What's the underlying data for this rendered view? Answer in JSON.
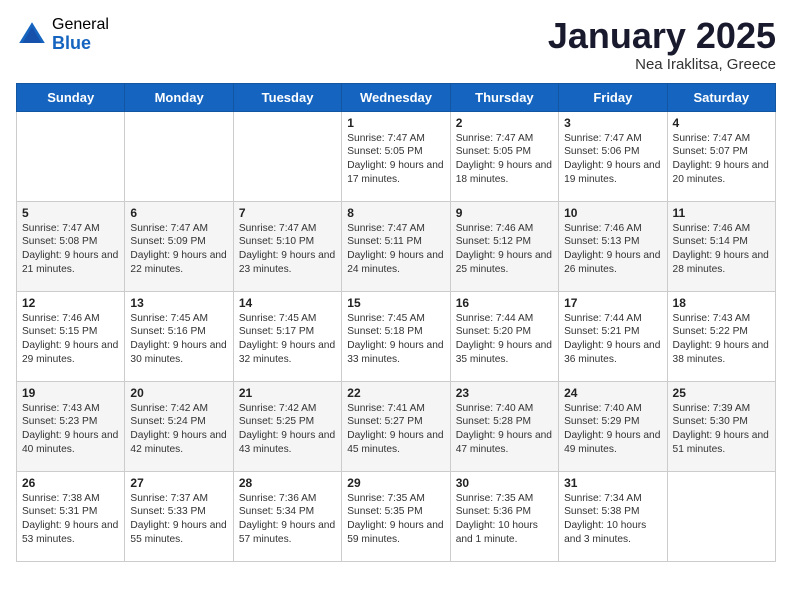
{
  "header": {
    "logo_general": "General",
    "logo_blue": "Blue",
    "title": "January 2025",
    "subtitle": "Nea Iraklitsa, Greece"
  },
  "weekdays": [
    "Sunday",
    "Monday",
    "Tuesday",
    "Wednesday",
    "Thursday",
    "Friday",
    "Saturday"
  ],
  "weeks": [
    [
      {
        "date": "",
        "info": ""
      },
      {
        "date": "",
        "info": ""
      },
      {
        "date": "",
        "info": ""
      },
      {
        "date": "1",
        "info": "Sunrise: 7:47 AM\nSunset: 5:05 PM\nDaylight: 9 hours and 17 minutes."
      },
      {
        "date": "2",
        "info": "Sunrise: 7:47 AM\nSunset: 5:05 PM\nDaylight: 9 hours and 18 minutes."
      },
      {
        "date": "3",
        "info": "Sunrise: 7:47 AM\nSunset: 5:06 PM\nDaylight: 9 hours and 19 minutes."
      },
      {
        "date": "4",
        "info": "Sunrise: 7:47 AM\nSunset: 5:07 PM\nDaylight: 9 hours and 20 minutes."
      }
    ],
    [
      {
        "date": "5",
        "info": "Sunrise: 7:47 AM\nSunset: 5:08 PM\nDaylight: 9 hours and 21 minutes."
      },
      {
        "date": "6",
        "info": "Sunrise: 7:47 AM\nSunset: 5:09 PM\nDaylight: 9 hours and 22 minutes."
      },
      {
        "date": "7",
        "info": "Sunrise: 7:47 AM\nSunset: 5:10 PM\nDaylight: 9 hours and 23 minutes."
      },
      {
        "date": "8",
        "info": "Sunrise: 7:47 AM\nSunset: 5:11 PM\nDaylight: 9 hours and 24 minutes."
      },
      {
        "date": "9",
        "info": "Sunrise: 7:46 AM\nSunset: 5:12 PM\nDaylight: 9 hours and 25 minutes."
      },
      {
        "date": "10",
        "info": "Sunrise: 7:46 AM\nSunset: 5:13 PM\nDaylight: 9 hours and 26 minutes."
      },
      {
        "date": "11",
        "info": "Sunrise: 7:46 AM\nSunset: 5:14 PM\nDaylight: 9 hours and 28 minutes."
      }
    ],
    [
      {
        "date": "12",
        "info": "Sunrise: 7:46 AM\nSunset: 5:15 PM\nDaylight: 9 hours and 29 minutes."
      },
      {
        "date": "13",
        "info": "Sunrise: 7:45 AM\nSunset: 5:16 PM\nDaylight: 9 hours and 30 minutes."
      },
      {
        "date": "14",
        "info": "Sunrise: 7:45 AM\nSunset: 5:17 PM\nDaylight: 9 hours and 32 minutes."
      },
      {
        "date": "15",
        "info": "Sunrise: 7:45 AM\nSunset: 5:18 PM\nDaylight: 9 hours and 33 minutes."
      },
      {
        "date": "16",
        "info": "Sunrise: 7:44 AM\nSunset: 5:20 PM\nDaylight: 9 hours and 35 minutes."
      },
      {
        "date": "17",
        "info": "Sunrise: 7:44 AM\nSunset: 5:21 PM\nDaylight: 9 hours and 36 minutes."
      },
      {
        "date": "18",
        "info": "Sunrise: 7:43 AM\nSunset: 5:22 PM\nDaylight: 9 hours and 38 minutes."
      }
    ],
    [
      {
        "date": "19",
        "info": "Sunrise: 7:43 AM\nSunset: 5:23 PM\nDaylight: 9 hours and 40 minutes."
      },
      {
        "date": "20",
        "info": "Sunrise: 7:42 AM\nSunset: 5:24 PM\nDaylight: 9 hours and 42 minutes."
      },
      {
        "date": "21",
        "info": "Sunrise: 7:42 AM\nSunset: 5:25 PM\nDaylight: 9 hours and 43 minutes."
      },
      {
        "date": "22",
        "info": "Sunrise: 7:41 AM\nSunset: 5:27 PM\nDaylight: 9 hours and 45 minutes."
      },
      {
        "date": "23",
        "info": "Sunrise: 7:40 AM\nSunset: 5:28 PM\nDaylight: 9 hours and 47 minutes."
      },
      {
        "date": "24",
        "info": "Sunrise: 7:40 AM\nSunset: 5:29 PM\nDaylight: 9 hours and 49 minutes."
      },
      {
        "date": "25",
        "info": "Sunrise: 7:39 AM\nSunset: 5:30 PM\nDaylight: 9 hours and 51 minutes."
      }
    ],
    [
      {
        "date": "26",
        "info": "Sunrise: 7:38 AM\nSunset: 5:31 PM\nDaylight: 9 hours and 53 minutes."
      },
      {
        "date": "27",
        "info": "Sunrise: 7:37 AM\nSunset: 5:33 PM\nDaylight: 9 hours and 55 minutes."
      },
      {
        "date": "28",
        "info": "Sunrise: 7:36 AM\nSunset: 5:34 PM\nDaylight: 9 hours and 57 minutes."
      },
      {
        "date": "29",
        "info": "Sunrise: 7:35 AM\nSunset: 5:35 PM\nDaylight: 9 hours and 59 minutes."
      },
      {
        "date": "30",
        "info": "Sunrise: 7:35 AM\nSunset: 5:36 PM\nDaylight: 10 hours and 1 minute."
      },
      {
        "date": "31",
        "info": "Sunrise: 7:34 AM\nSunset: 5:38 PM\nDaylight: 10 hours and 3 minutes."
      },
      {
        "date": "",
        "info": ""
      }
    ]
  ]
}
